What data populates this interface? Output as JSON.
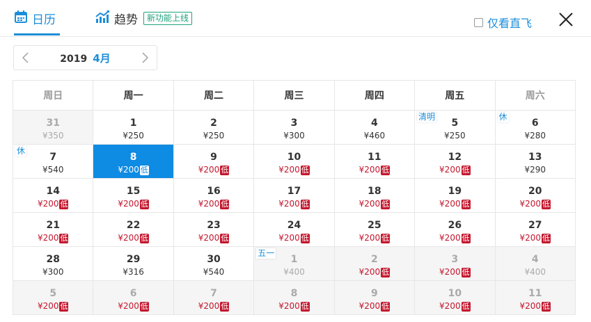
{
  "header": {
    "tabs": [
      {
        "label": "日历",
        "icon": "calendar-icon",
        "active": true
      },
      {
        "label": "趋势",
        "icon": "trend-chart-icon",
        "active": false
      }
    ],
    "new_badge": "新功能上线",
    "direct_only_label": "仅看直飞",
    "close_icon": "close-icon"
  },
  "colors": {
    "accent": "#1d8ed8",
    "low_price": "#c4162d",
    "new_badge": "#1ea37c",
    "selected_bg": "#0e8be3"
  },
  "month_nav": {
    "year": "2019",
    "month": "4月"
  },
  "calendar": {
    "weekdays": [
      "周日",
      "周一",
      "周二",
      "周三",
      "周四",
      "周五",
      "周六"
    ],
    "weeks": [
      [
        {
          "day": "31",
          "price": "¥350",
          "muted": true
        },
        {
          "day": "1",
          "price": "¥250"
        },
        {
          "day": "2",
          "price": "¥250"
        },
        {
          "day": "3",
          "price": "¥300"
        },
        {
          "day": "4",
          "price": "¥460"
        },
        {
          "day": "5",
          "price": "¥250",
          "holiday": "清明"
        },
        {
          "day": "6",
          "price": "¥280",
          "holiday": "休"
        }
      ],
      [
        {
          "day": "7",
          "price": "¥540",
          "holiday": "休"
        },
        {
          "day": "8",
          "price": "¥200",
          "low": "低",
          "selected": true
        },
        {
          "day": "9",
          "price": "¥200",
          "low": "低"
        },
        {
          "day": "10",
          "price": "¥200",
          "low": "低"
        },
        {
          "day": "11",
          "price": "¥200",
          "low": "低"
        },
        {
          "day": "12",
          "price": "¥200",
          "low": "低"
        },
        {
          "day": "13",
          "price": "¥290"
        }
      ],
      [
        {
          "day": "14",
          "price": "¥200",
          "low": "低"
        },
        {
          "day": "15",
          "price": "¥200",
          "low": "低"
        },
        {
          "day": "16",
          "price": "¥200",
          "low": "低"
        },
        {
          "day": "17",
          "price": "¥200",
          "low": "低"
        },
        {
          "day": "18",
          "price": "¥200",
          "low": "低"
        },
        {
          "day": "19",
          "price": "¥200",
          "low": "低"
        },
        {
          "day": "20",
          "price": "¥200",
          "low": "低"
        }
      ],
      [
        {
          "day": "21",
          "price": "¥200",
          "low": "低"
        },
        {
          "day": "22",
          "price": "¥200",
          "low": "低"
        },
        {
          "day": "23",
          "price": "¥200",
          "low": "低"
        },
        {
          "day": "24",
          "price": "¥200",
          "low": "低"
        },
        {
          "day": "25",
          "price": "¥200",
          "low": "低"
        },
        {
          "day": "26",
          "price": "¥200",
          "low": "低"
        },
        {
          "day": "27",
          "price": "¥200",
          "low": "低"
        }
      ],
      [
        {
          "day": "28",
          "price": "¥300"
        },
        {
          "day": "29",
          "price": "¥316"
        },
        {
          "day": "30",
          "price": "¥540"
        },
        {
          "day": "1",
          "price": "¥400",
          "muted": true,
          "holiday": "五一"
        },
        {
          "day": "2",
          "price": "¥200",
          "low": "低",
          "muted": true
        },
        {
          "day": "3",
          "price": "¥200",
          "low": "低",
          "muted": true
        },
        {
          "day": "4",
          "price": "¥400",
          "muted": true
        }
      ],
      [
        {
          "day": "5",
          "price": "¥200",
          "low": "低",
          "muted": true
        },
        {
          "day": "6",
          "price": "¥200",
          "low": "低",
          "muted": true
        },
        {
          "day": "7",
          "price": "¥200",
          "low": "低",
          "muted": true
        },
        {
          "day": "8",
          "price": "¥200",
          "low": "低",
          "muted": true
        },
        {
          "day": "9",
          "price": "¥200",
          "low": "低",
          "muted": true
        },
        {
          "day": "10",
          "price": "¥200",
          "low": "低",
          "muted": true
        },
        {
          "day": "11",
          "price": "¥200",
          "low": "低",
          "muted": true
        }
      ]
    ]
  }
}
